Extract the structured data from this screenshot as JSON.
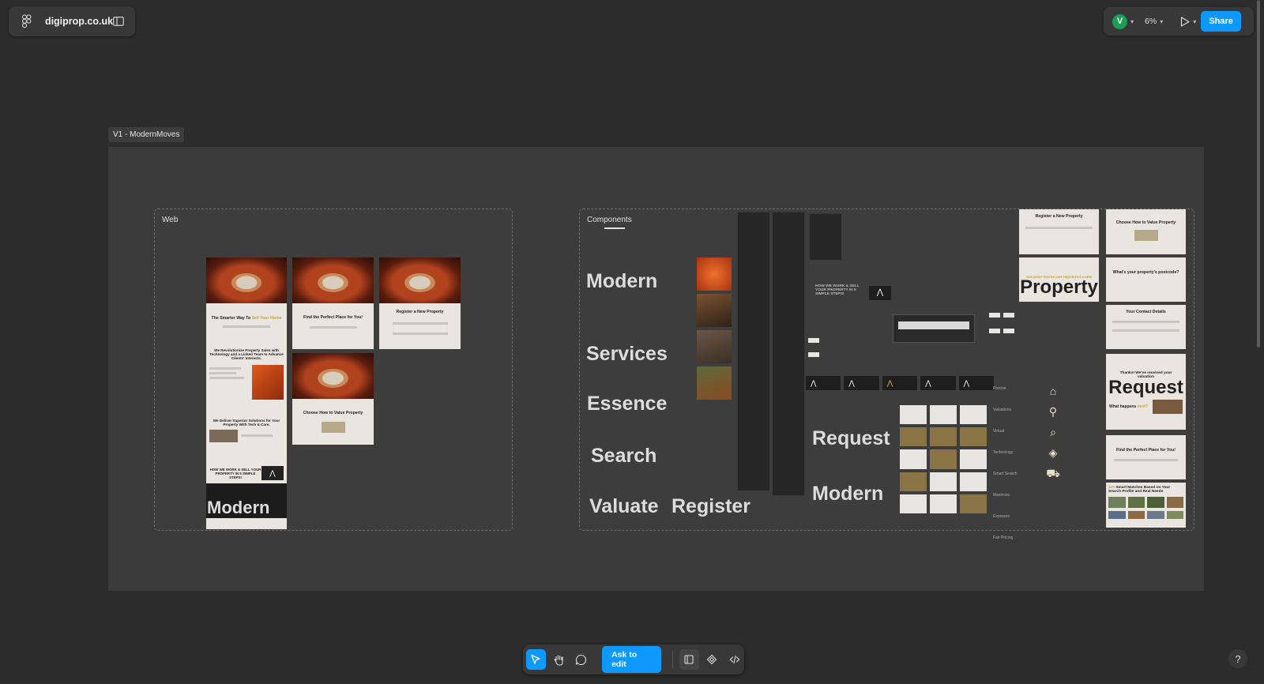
{
  "file": {
    "name": "digiprop.co.uk"
  },
  "toolbar": {
    "avatar_initial": "V",
    "zoom": "6%",
    "share_label": "Share"
  },
  "frame": {
    "label": "V1 - ModernMoves"
  },
  "web": {
    "label": "Web",
    "screens": {
      "home_title_a": "The Smarter Way To ",
      "home_title_b": "Sell Your Home",
      "revolutionize": "We Revolutionize Property Sales with Technology and a Linked Team to Advance Clients' Interests.",
      "superior": "We Deliver Superior Solutions for Your Property With Tech & Care.",
      "how_we_work": "HOW WE WORK & SELL YOUR PROPERTY IN 5 SIMPLE STEPS!",
      "modern": "Modern",
      "find_place": "Find the Perfect Place for You!",
      "register": "Register a New Property",
      "choose_value": "Choose How to Value Property"
    }
  },
  "components": {
    "label": "Components",
    "words": {
      "modern1": "Modern",
      "services": "Services",
      "essence": "Essence",
      "search": "Search",
      "valuate": "Valuate",
      "register": "Register",
      "request": "Request",
      "modern2": "Modern",
      "how_we_work": "HOW WE WORK & SELL YOUR PROPERTY IN 5 SIMPLE STEPS!",
      "features": [
        "Precise Valuations",
        "Virtual Technology",
        "Smart Search",
        "Maximise Exposure",
        "Fair Pricing"
      ]
    },
    "right_col": {
      "register_title": "Register a New Property",
      "success": "Success! You've just registered a new",
      "property": "Property",
      "choose_value": "Choose How to Value Property",
      "postcode": "What's your property's postcode?",
      "contact": "Your Contact Details",
      "thanks": "Thanks! We've received your valuation",
      "request_big": "Request",
      "what_happens_a": "What happens ",
      "what_happens_b": "next?",
      "find_place": "Find the Perfect Place for You!",
      "smart_matches_a": "125 ",
      "smart_matches_b": "Smart Matches Based on Your Search Profile and Real Needs"
    }
  },
  "bottom": {
    "ask_label": "Ask to edit"
  },
  "help": {
    "label": "?"
  }
}
